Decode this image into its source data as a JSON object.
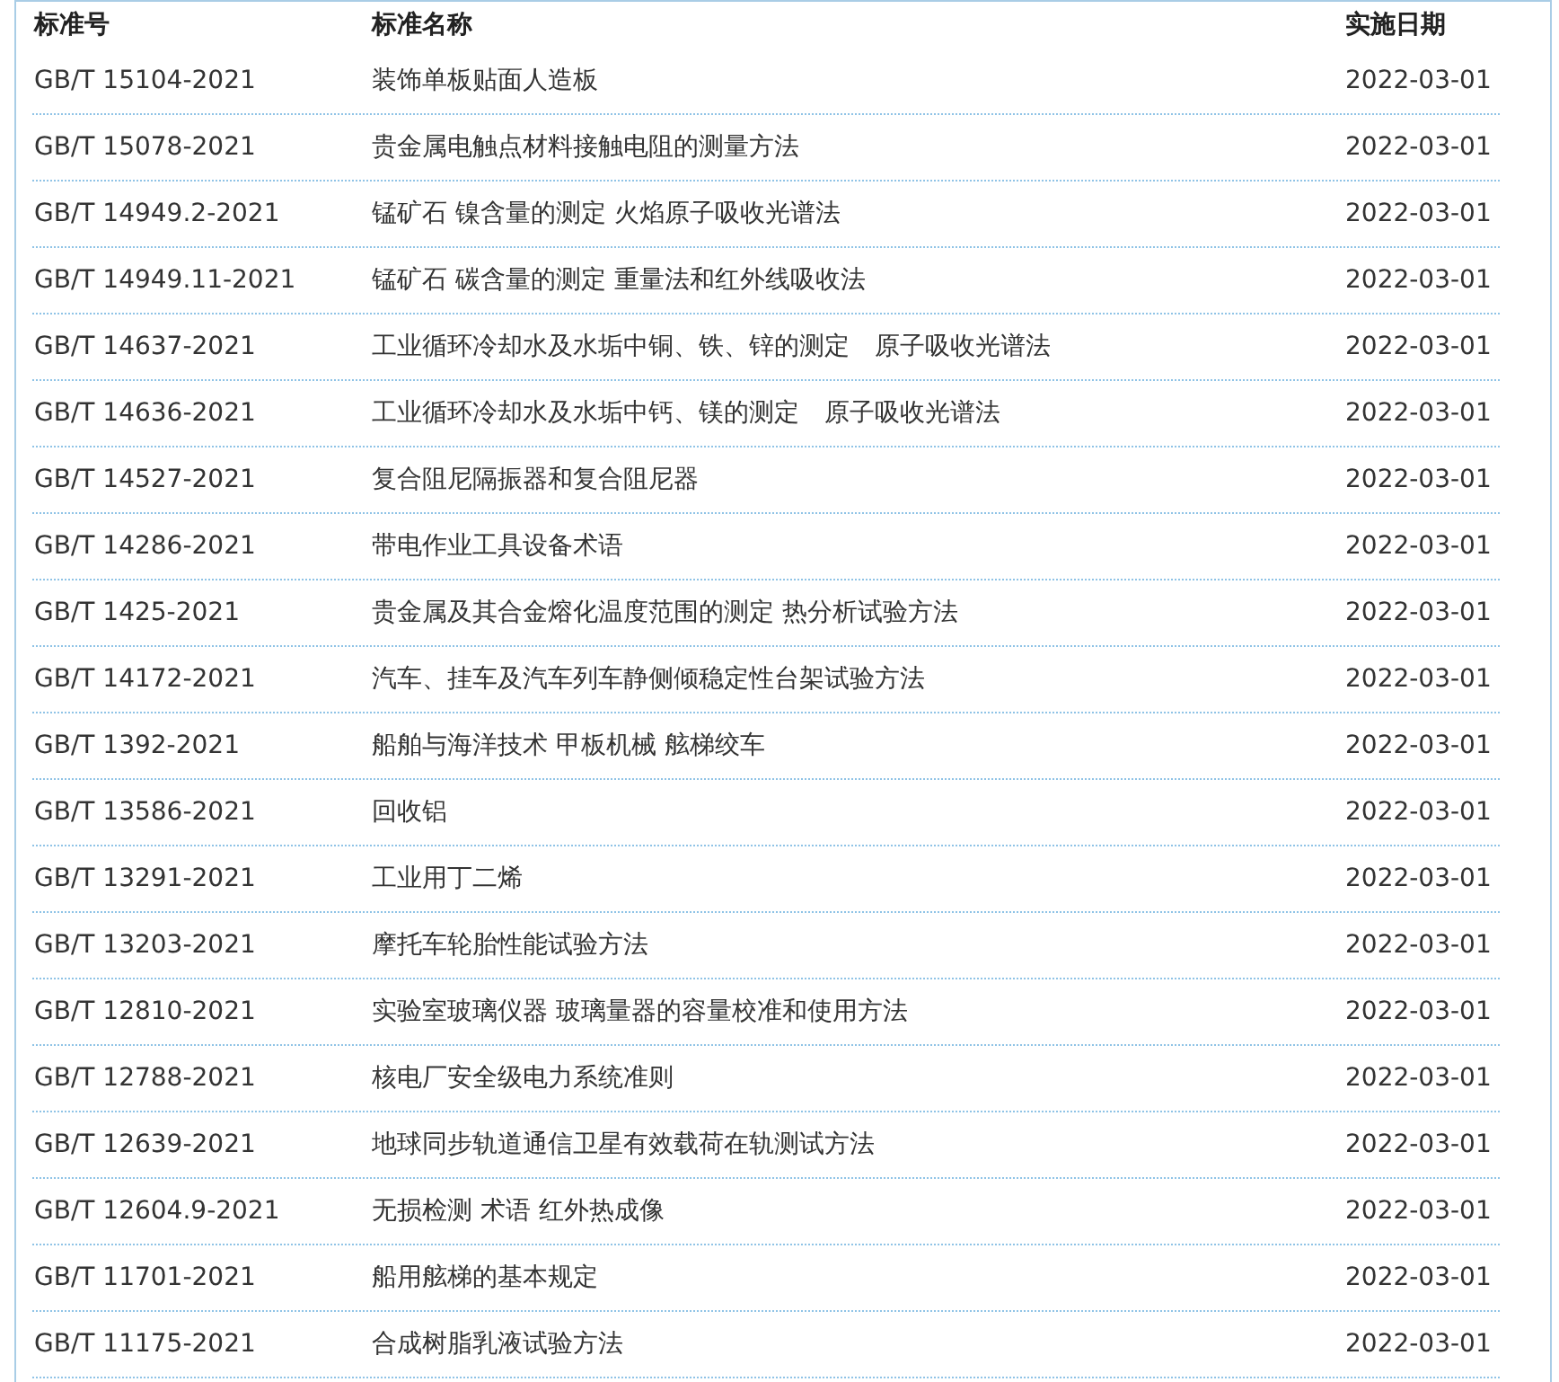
{
  "table": {
    "columns": [
      "标准号",
      "标准名称",
      "实施日期"
    ],
    "rows": [
      [
        "GB/T 15104-2021",
        "装饰单板贴面人造板",
        "2022-03-01"
      ],
      [
        "GB/T 15078-2021",
        "贵金属电触点材料接触电阻的测量方法",
        "2022-03-01"
      ],
      [
        "GB/T 14949.2-2021",
        "锰矿石 镍含量的测定 火焰原子吸收光谱法",
        "2022-03-01"
      ],
      [
        "GB/T 14949.11-2021",
        "锰矿石 碳含量的测定 重量法和红外线吸收法",
        "2022-03-01"
      ],
      [
        "GB/T 14637-2021",
        "工业循环冷却水及水垢中铜、铁、锌的测定　原子吸收光谱法",
        "2022-03-01"
      ],
      [
        "GB/T 14636-2021",
        "工业循环冷却水及水垢中钙、镁的测定　原子吸收光谱法",
        "2022-03-01"
      ],
      [
        "GB/T 14527-2021",
        "复合阻尼隔振器和复合阻尼器",
        "2022-03-01"
      ],
      [
        "GB/T 14286-2021",
        "带电作业工具设备术语",
        "2022-03-01"
      ],
      [
        "GB/T 1425-2021",
        "贵金属及其合金熔化温度范围的测定 热分析试验方法",
        "2022-03-01"
      ],
      [
        "GB/T 14172-2021",
        "汽车、挂车及汽车列车静侧倾稳定性台架试验方法",
        "2022-03-01"
      ],
      [
        "GB/T 1392-2021",
        "船舶与海洋技术 甲板机械 舷梯绞车",
        "2022-03-01"
      ],
      [
        "GB/T 13586-2021",
        "回收铝",
        "2022-03-01"
      ],
      [
        "GB/T 13291-2021",
        "工业用丁二烯",
        "2022-03-01"
      ],
      [
        "GB/T 13203-2021",
        "摩托车轮胎性能试验方法",
        "2022-03-01"
      ],
      [
        "GB/T 12810-2021",
        "实验室玻璃仪器 玻璃量器的容量校准和使用方法",
        "2022-03-01"
      ],
      [
        "GB/T 12788-2021",
        "核电厂安全级电力系统准则",
        "2022-03-01"
      ],
      [
        "GB/T 12639-2021",
        "地球同步轨道通信卫星有效载荷在轨测试方法",
        "2022-03-01"
      ],
      [
        "GB/T 12604.9-2021",
        "无损检测 术语 红外热成像",
        "2022-03-01"
      ],
      [
        "GB/T 11701-2021",
        "船用舷梯的基本规定",
        "2022-03-01"
      ],
      [
        "GB/T 11175-2021",
        "合成树脂乳液试验方法",
        "2022-03-01"
      ]
    ]
  }
}
